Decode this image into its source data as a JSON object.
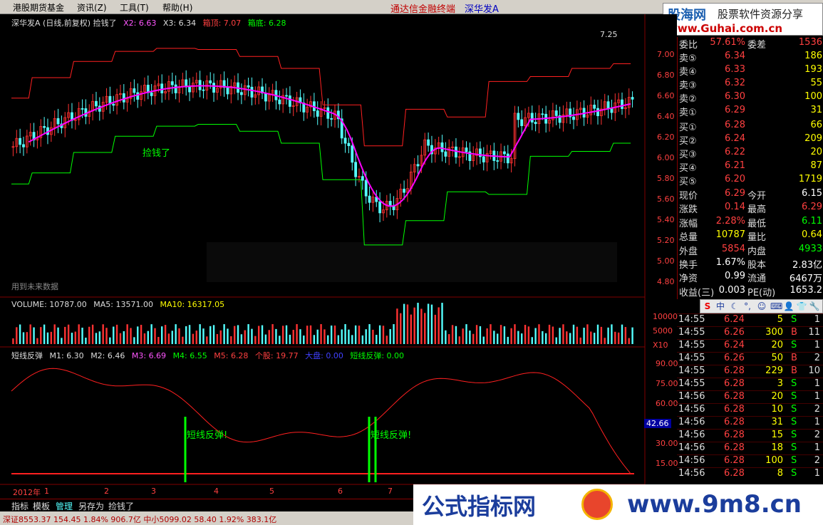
{
  "menubar": {
    "items": [
      "港股期货基金",
      "资讯(Z)",
      "工具(T)",
      "帮助(H)"
    ],
    "title": "通达信金融终端",
    "stock": "深华发A"
  },
  "top_logo": {
    "site": "股海网",
    "tagline": "股票软件资源分享",
    "url": "www.Guhai.com.cn"
  },
  "price_legend": {
    "name": "深华发A (日线,前复权) 捡钱了",
    "x2": "X2: 6.63",
    "x3": "X3: 6.34",
    "top": "箱顶: 7.07",
    "bottom": "箱底: 6.28",
    "max_label": "7.25",
    "buy_label": "捡钱了",
    "future_note": "用到未来数据"
  },
  "price_axis": [
    "7.00",
    "6.80",
    "6.60",
    "6.40",
    "6.20",
    "6.00",
    "5.80",
    "5.60",
    "5.40",
    "5.20",
    "5.00",
    "4.80"
  ],
  "volume_legend": {
    "vol": "VOLUME: 10787.00",
    "ma5": "MA5: 13571.00",
    "ma10": "MA10: 16317.05"
  },
  "volume_axis": [
    "10000",
    "5000",
    "X10"
  ],
  "osc_legend": {
    "name": "短线反弹",
    "m1": "M1: 6.30",
    "m2": "M2: 6.46",
    "m3": "M3: 6.69",
    "m4": "M4: 6.55",
    "m5": "M5: 6.28",
    "gegu": "个股: 19.77",
    "dapan": "大盘: 0.00",
    "dxft": "短线反弹: 0.00",
    "signal_label": "短线反弹!"
  },
  "osc_axis": [
    "90.00",
    "75.00",
    "60.00",
    "42.66",
    "30.00",
    "15.00"
  ],
  "date_axis": [
    "2012年",
    "1",
    "2",
    "3",
    "4",
    "5",
    "6",
    "7"
  ],
  "info_panel": {
    "weibi": {
      "label": "委比",
      "value": "57.61%",
      "label2": "委差",
      "value2": "1536"
    },
    "asks": [
      {
        "label": "卖⑤",
        "price": "6.34",
        "vol": "186"
      },
      {
        "label": "卖④",
        "price": "6.33",
        "vol": "193"
      },
      {
        "label": "卖③",
        "price": "6.32",
        "vol": "55"
      },
      {
        "label": "卖②",
        "price": "6.30",
        "vol": "100"
      },
      {
        "label": "卖①",
        "price": "6.29",
        "vol": "31"
      }
    ],
    "bids": [
      {
        "label": "买①",
        "price": "6.28",
        "vol": "66"
      },
      {
        "label": "买②",
        "price": "6.24",
        "vol": "209"
      },
      {
        "label": "买③",
        "price": "6.22",
        "vol": "20"
      },
      {
        "label": "买④",
        "price": "6.21",
        "vol": "87"
      },
      {
        "label": "买⑤",
        "price": "6.20",
        "vol": "1719"
      }
    ],
    "stats": [
      {
        "l1": "现价",
        "v1": "6.29",
        "l2": "今开",
        "v2": "6.15",
        "c1": "#ff4040",
        "c2": "#ffffff"
      },
      {
        "l1": "涨跌",
        "v1": "0.14",
        "l2": "最高",
        "v2": "6.29",
        "c1": "#ff4040",
        "c2": "#ff4040"
      },
      {
        "l1": "涨幅",
        "v1": "2.28%",
        "l2": "最低",
        "v2": "6.11",
        "c1": "#ff4040",
        "c2": "#00ff00"
      },
      {
        "l1": "总量",
        "v1": "10787",
        "l2": "量比",
        "v2": "0.64",
        "c1": "#ffff00",
        "c2": "#ffff00"
      },
      {
        "l1": "外盘",
        "v1": "5854",
        "l2": "内盘",
        "v2": "4933",
        "c1": "#ff4040",
        "c2": "#00ff00"
      },
      {
        "l1": "换手",
        "v1": "1.67%",
        "l2": "股本",
        "v2": "2.83亿",
        "c1": "#ffffff",
        "c2": "#ffffff"
      },
      {
        "l1": "净资",
        "v1": "0.99",
        "l2": "流通",
        "v2": "6467万",
        "c1": "#ffffff",
        "c2": "#ffffff"
      },
      {
        "l1": "收益(三)",
        "v1": "0.003",
        "l2": "PE(动)",
        "v2": "1653.2",
        "c1": "#ffffff",
        "c2": "#ffffff"
      }
    ]
  },
  "ticks": [
    {
      "time": "14:55",
      "price": "6.24",
      "vol": "5",
      "side": "S",
      "n": "1"
    },
    {
      "time": "14:55",
      "price": "6.26",
      "vol": "300",
      "side": "B",
      "n": "11"
    },
    {
      "time": "14:55",
      "price": "6.24",
      "vol": "20",
      "side": "S",
      "n": "1"
    },
    {
      "time": "14:55",
      "price": "6.26",
      "vol": "50",
      "side": "B",
      "n": "2"
    },
    {
      "time": "14:55",
      "price": "6.28",
      "vol": "229",
      "side": "B",
      "n": "10"
    },
    {
      "time": "14:55",
      "price": "6.28",
      "vol": "3",
      "side": "S",
      "n": "1"
    },
    {
      "time": "14:56",
      "price": "6.28",
      "vol": "20",
      "side": "S",
      "n": "1"
    },
    {
      "time": "14:56",
      "price": "6.28",
      "vol": "10",
      "side": "S",
      "n": "2"
    },
    {
      "time": "14:56",
      "price": "6.28",
      "vol": "31",
      "side": "S",
      "n": "1"
    },
    {
      "time": "14:56",
      "price": "6.28",
      "vol": "15",
      "side": "S",
      "n": "2"
    },
    {
      "time": "14:56",
      "price": "6.28",
      "vol": "18",
      "side": "S",
      "n": "1"
    },
    {
      "time": "14:56",
      "price": "6.28",
      "vol": "100",
      "side": "S",
      "n": "2"
    },
    {
      "time": "14:56",
      "price": "6.28",
      "vol": "8",
      "side": "S",
      "n": "1"
    }
  ],
  "bottom_tabs": [
    "指标",
    "模板",
    "管理",
    "另存为",
    "捡钱了"
  ],
  "statusbar": {
    "text": "深证8553.37  154.45  1.84%  906.7亿  中小5099.02  58.40  1.92%  383.1亿"
  },
  "bottom_banner": {
    "left": "公式指标网",
    "right": "www.9m8.cn"
  },
  "colors": {
    "up": "#ff3232",
    "down": "#54ffff",
    "green_box": "#00ff00",
    "ma": "#ff00ff",
    "axis": "#800000"
  }
}
